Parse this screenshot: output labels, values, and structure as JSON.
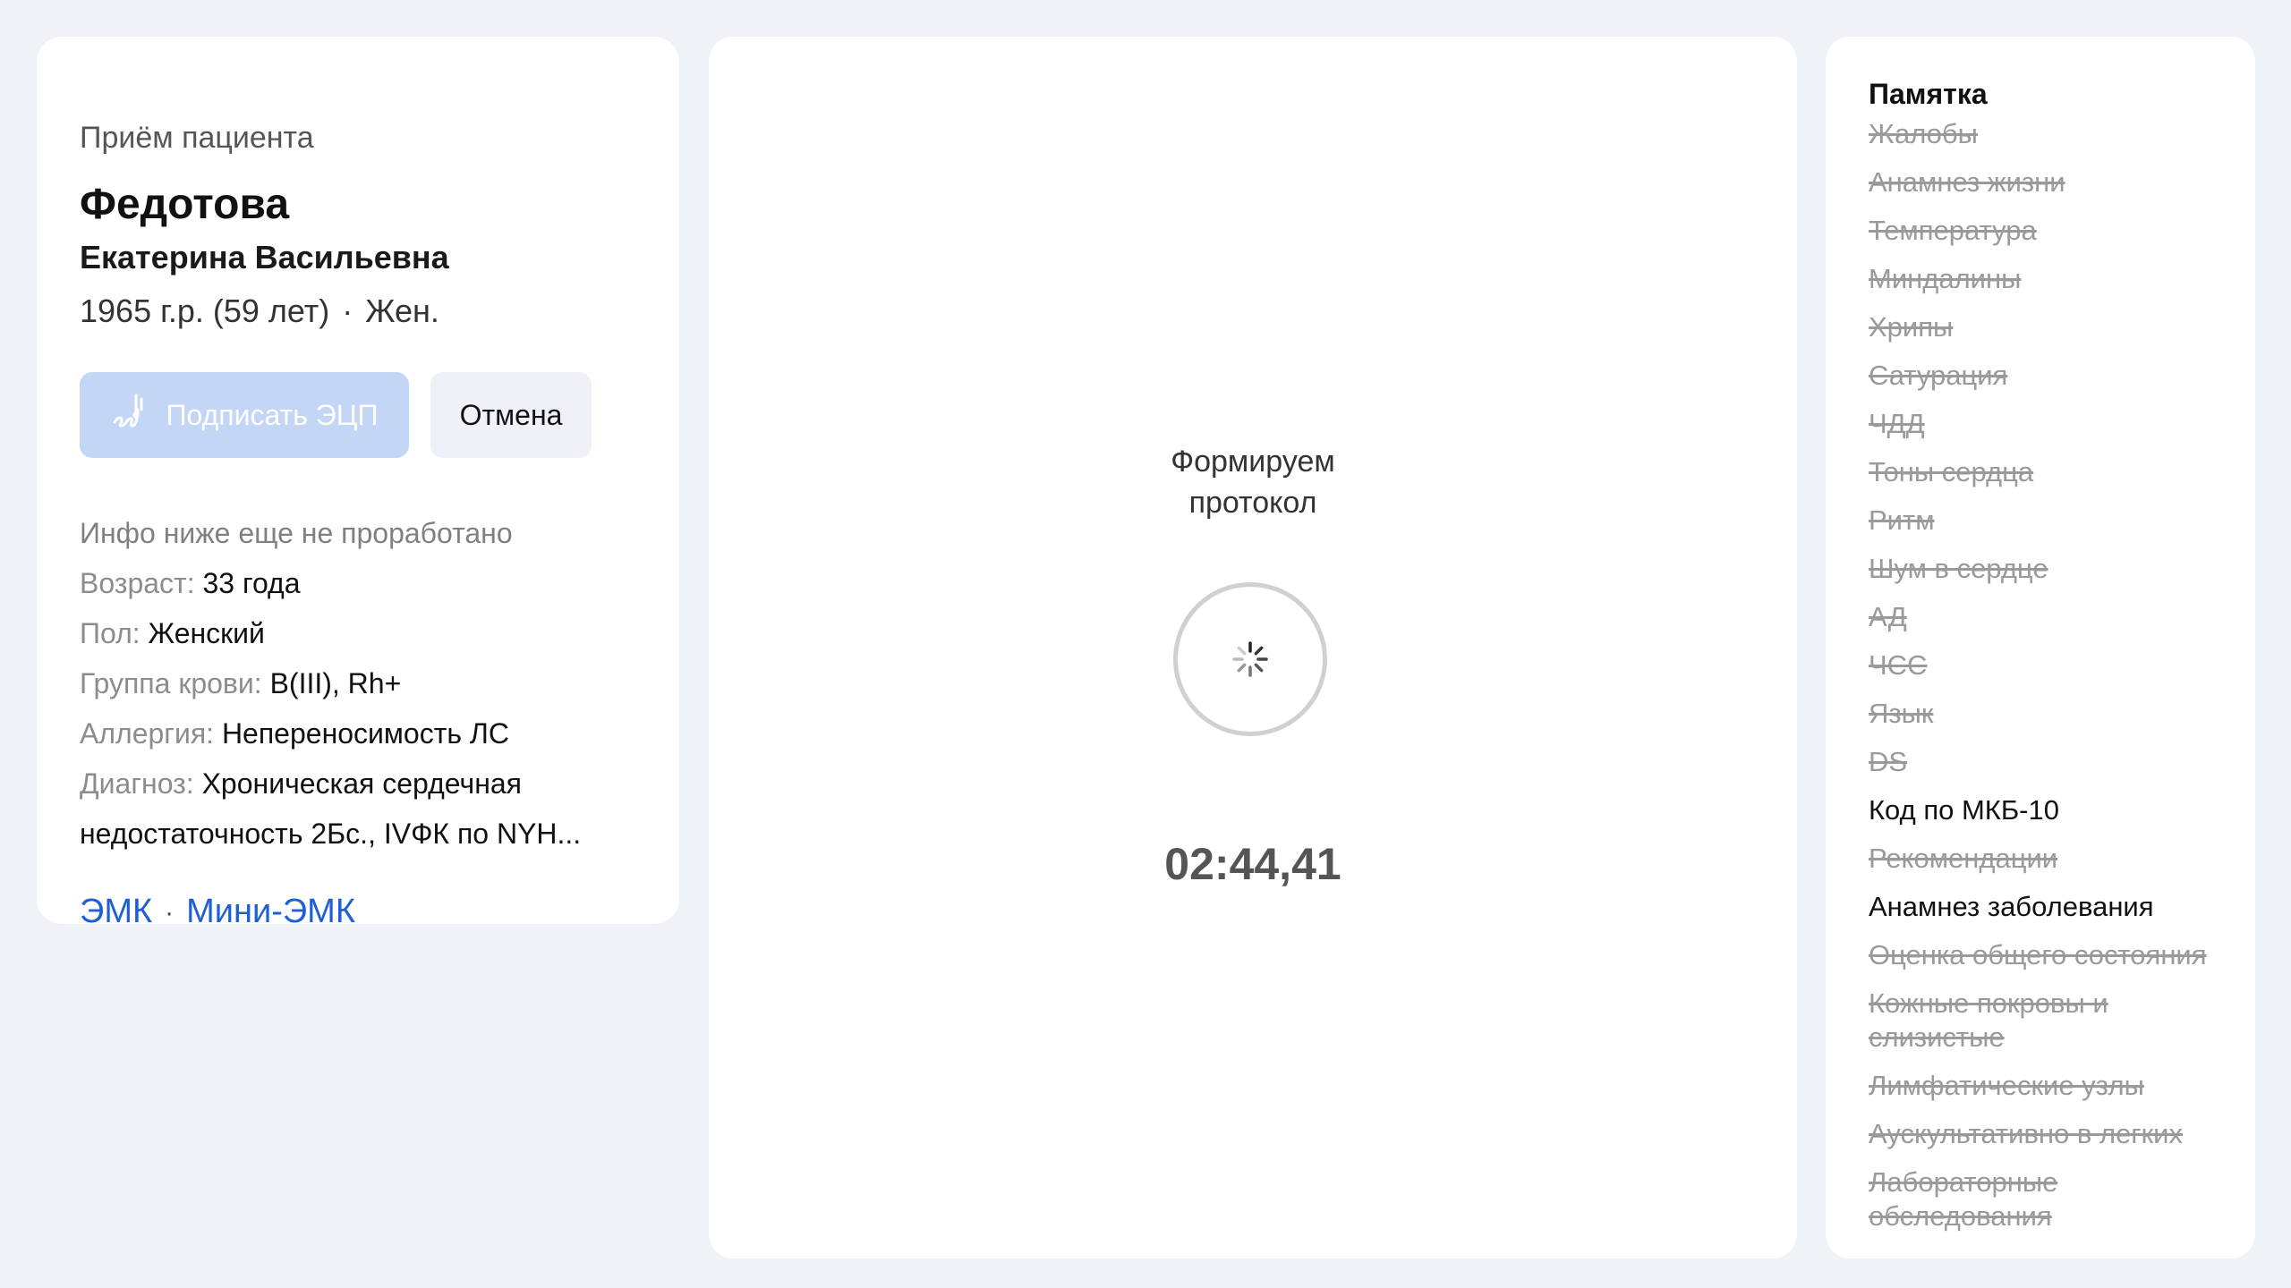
{
  "patient": {
    "header": "Приём пациента",
    "surname": "Федотова",
    "given_names": "Екатерина Васильевна",
    "birth_year": "1965 г.р. (59 лет)",
    "sex_short": "Жен."
  },
  "actions": {
    "sign_label": "Подписать ЭЦП",
    "cancel_label": "Отмена"
  },
  "info": {
    "note": "Инфо ниже еще не проработано",
    "age_label": "Возраст:",
    "age_value": "33 года",
    "sex_label": "Пол:",
    "sex_value": "Женский",
    "blood_label": "Группа крови:",
    "blood_value": "B(III), Rh+",
    "allergy_label": "Аллергия:",
    "allergy_value": "Непереносимость ЛС",
    "diagnosis_label": "Диагноз:",
    "diagnosis_value": "Хроническая сердечная недостаточность 2Бс., IVФК по NYH..."
  },
  "links": {
    "emk": "ЭМК",
    "mini_emk": "Мини-ЭМК"
  },
  "protocol": {
    "status_line1": "Формируем",
    "status_line2": "протокол",
    "timer": "02:44,41"
  },
  "memo": {
    "title": "Памятка",
    "items": [
      {
        "label": "Жалобы",
        "done": true
      },
      {
        "label": "Анамнез жизни",
        "done": true
      },
      {
        "label": "Температура",
        "done": true
      },
      {
        "label": "Миндалины",
        "done": true
      },
      {
        "label": "Хрипы",
        "done": true
      },
      {
        "label": "Сатурация",
        "done": true
      },
      {
        "label": "ЧДД",
        "done": true
      },
      {
        "label": "Тоны сердца",
        "done": true
      },
      {
        "label": "Ритм",
        "done": true
      },
      {
        "label": "Шум в сердце",
        "done": true
      },
      {
        "label": "АД",
        "done": true
      },
      {
        "label": "ЧСС",
        "done": true
      },
      {
        "label": "Язык",
        "done": true
      },
      {
        "label": "DS",
        "done": true
      },
      {
        "label": "Код по МКБ-10",
        "done": false
      },
      {
        "label": "Рекомендации",
        "done": true
      },
      {
        "label": "Анамнез заболевания",
        "done": false
      },
      {
        "label": "Оценка общего состояния",
        "done": true
      },
      {
        "label": "Кожные покровы и слизистые",
        "done": true
      },
      {
        "label": "Лимфатические узлы",
        "done": true
      },
      {
        "label": "Аускультативно в легких",
        "done": true
      },
      {
        "label": "Лабораторные обследования",
        "done": true
      }
    ]
  },
  "colors": {
    "background": "#eff3f8",
    "link": "#1f5fd6",
    "sign_button_disabled": "#c4d6f6",
    "cancel_button": "#eef2f8"
  },
  "icons": {
    "sign": "signature-icon",
    "spinner": "loading-spinner-icon"
  }
}
